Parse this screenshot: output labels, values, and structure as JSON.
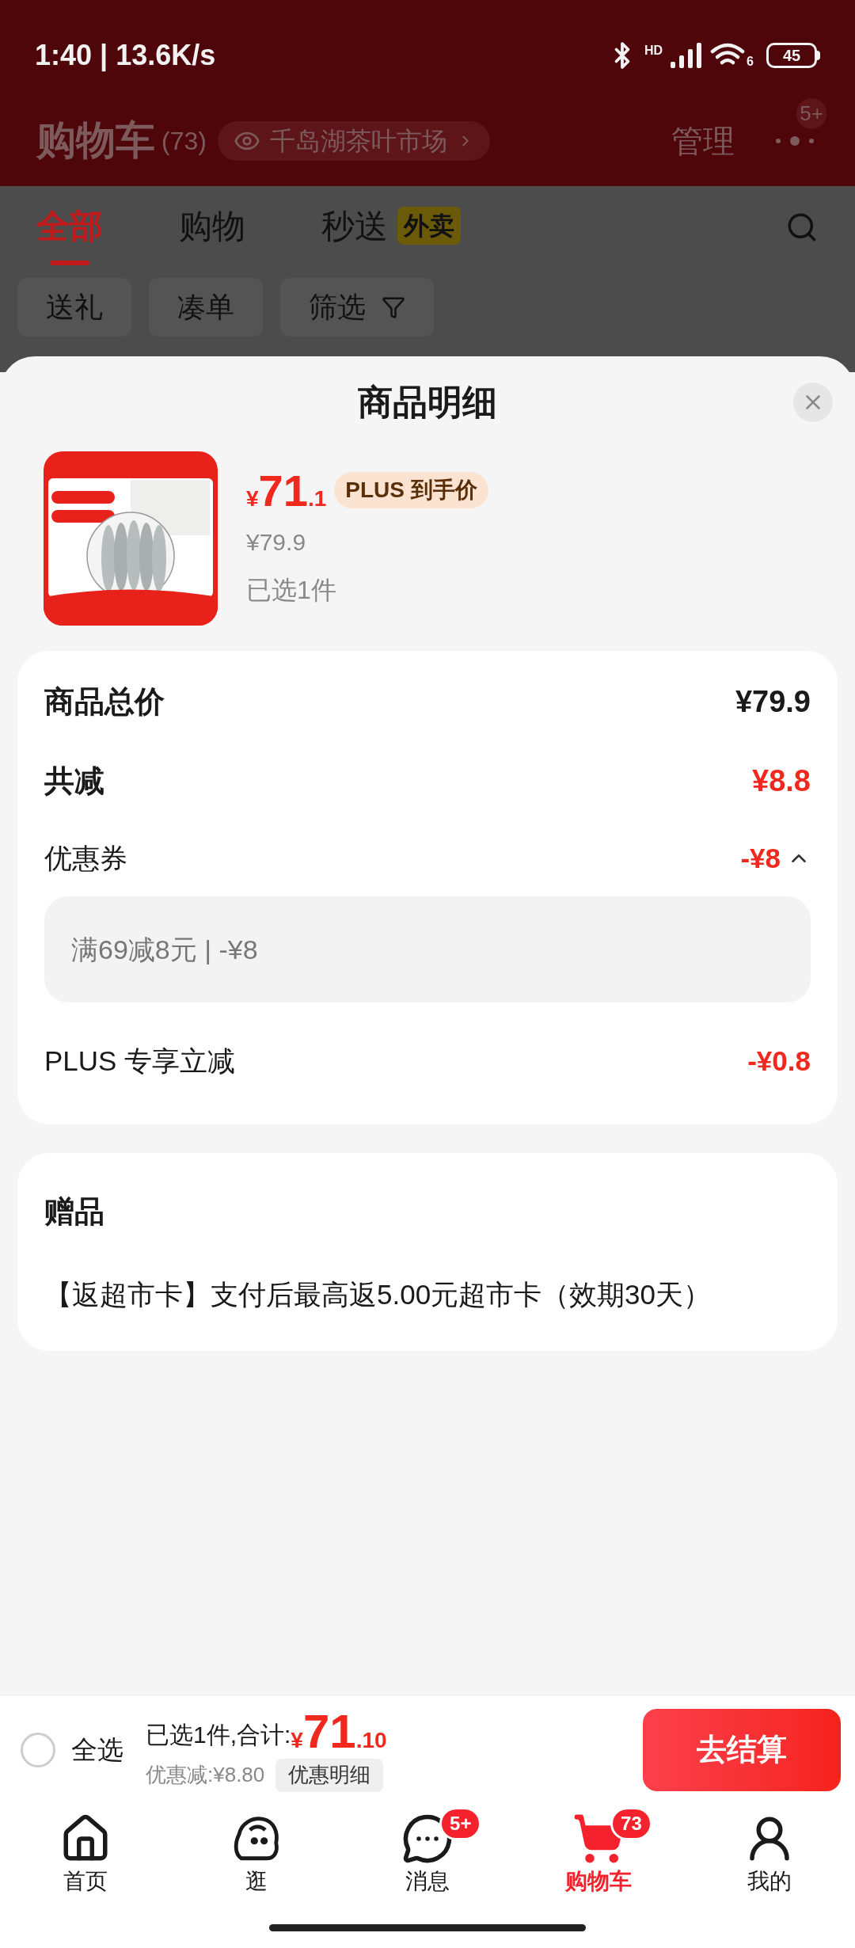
{
  "status_bar": {
    "time": "1:40 | 13.6K/s",
    "signal_label": "HD",
    "wifi_label": "6",
    "battery": "45"
  },
  "header": {
    "title": "购物车",
    "count": "(73)",
    "location": "千岛湖茶叶市场",
    "manage": "管理",
    "more_badge": "5+"
  },
  "tabs": [
    {
      "label": "全部",
      "selected": true
    },
    {
      "label": "购物",
      "selected": false
    },
    {
      "label": "秒送",
      "selected": false,
      "badge": "外卖"
    }
  ],
  "filters": [
    {
      "label": "送礼",
      "kind": "plain"
    },
    {
      "label": "凑单",
      "kind": "plain"
    },
    {
      "label": "筛选",
      "kind": "filter"
    }
  ],
  "sheet": {
    "title": "商品明细",
    "product": {
      "kind": "picture",
      "currency": "¥",
      "price_int": "71",
      "price_dec": ".1",
      "tag": "PLUS 到手价",
      "original_price": "¥79.9",
      "selected_count": "已选1件"
    },
    "summary": [
      {
        "kind": "total",
        "label": "商品总价",
        "value": "¥79.9"
      },
      {
        "kind": "discount",
        "label": "共减",
        "value": "¥8.8"
      },
      {
        "kind": "coupon",
        "label": "优惠券",
        "value": "-¥8",
        "expanded": true,
        "detail": "满69减8元 | -¥8"
      },
      {
        "kind": "item",
        "label": "PLUS 专享立减",
        "value": "-¥0.8"
      }
    ],
    "gift": {
      "title": "赠品",
      "text": "【返超市卡】支付后最高返5.00元超市卡（效期30天）"
    }
  },
  "checkout": {
    "select_all": {
      "label": "全选",
      "checked": false
    },
    "summary_label": "已选1件,合计:",
    "currency": "¥",
    "total_int": "71",
    "total_dec": ".10",
    "discount": "优惠减:¥8.80",
    "detail_button": "优惠明细",
    "submit": "去结算"
  },
  "nav": [
    {
      "label": "首页",
      "kind": "home",
      "selected": false
    },
    {
      "label": "逛",
      "kind": "browse",
      "selected": false
    },
    {
      "label": "消息",
      "kind": "message",
      "selected": false,
      "badge": "5+"
    },
    {
      "label": "购物车",
      "kind": "cart",
      "selected": true,
      "badge": "73"
    },
    {
      "label": "我的",
      "kind": "user",
      "selected": false
    }
  ]
}
